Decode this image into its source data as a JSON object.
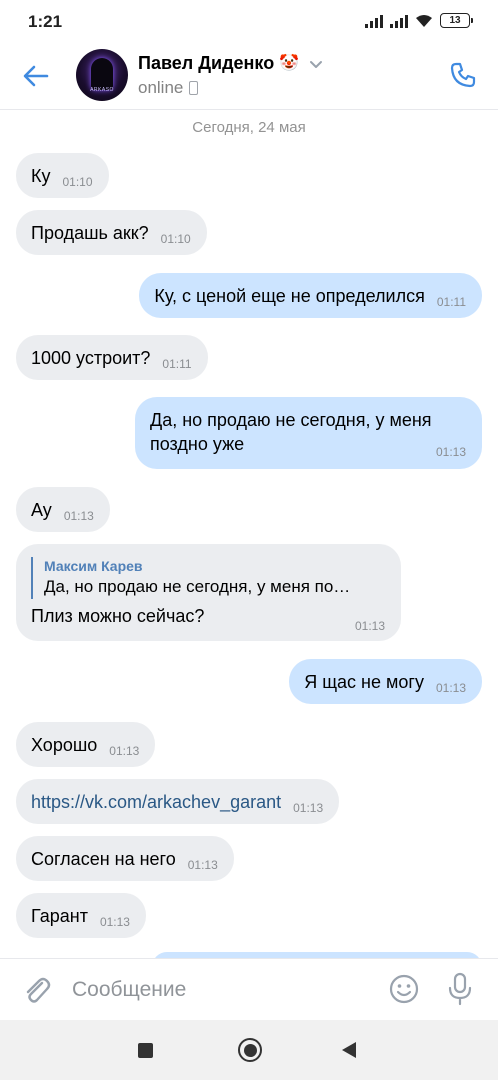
{
  "status_bar": {
    "time": "1:21",
    "battery": "13"
  },
  "header": {
    "contact_name": "Павел Диденко",
    "name_emoji": "🤡",
    "presence": "online",
    "avatar_text": "ARKASO"
  },
  "date_divider": "Сегодня, 24 мая",
  "messages": [
    {
      "dir": "in",
      "text": "Ку",
      "time": "01:10"
    },
    {
      "dir": "in",
      "text": "Продашь акк?",
      "time": "01:10"
    },
    {
      "dir": "out",
      "text": "Ку, с ценой еще не определился",
      "time": "01:11"
    },
    {
      "dir": "in",
      "text": "1000 устроит?",
      "time": "01:11"
    },
    {
      "dir": "out",
      "text_line1": "Да, но продаю не сегодня, у меня",
      "text_line2": "поздно уже",
      "time": "01:13"
    },
    {
      "dir": "in",
      "text": "Ау",
      "time": "01:13"
    },
    {
      "dir": "in",
      "reply_author": "Максим Карев",
      "reply_text": "Да, но продаю не сегодня, у меня по…",
      "text": "Плиз можно сейчас?",
      "time": "01:13"
    },
    {
      "dir": "out",
      "text": "Я щас не могу",
      "time": "01:13"
    },
    {
      "dir": "in",
      "text": "Хорошо",
      "time": "01:13"
    },
    {
      "dir": "in",
      "text": "https://vk.com/arkachev_garant",
      "time": "01:13",
      "is_link": true
    },
    {
      "dir": "in",
      "text": "Согласен на него",
      "time": "01:13"
    },
    {
      "dir": "in",
      "text": "Гарант",
      "time": "01:13"
    }
  ],
  "composer": {
    "placeholder": "Сообщение"
  },
  "colors": {
    "accent": "#5181b8",
    "incoming_bubble": "#ebedf0",
    "outgoing_bubble": "#cce4ff",
    "link": "#2a5885"
  }
}
